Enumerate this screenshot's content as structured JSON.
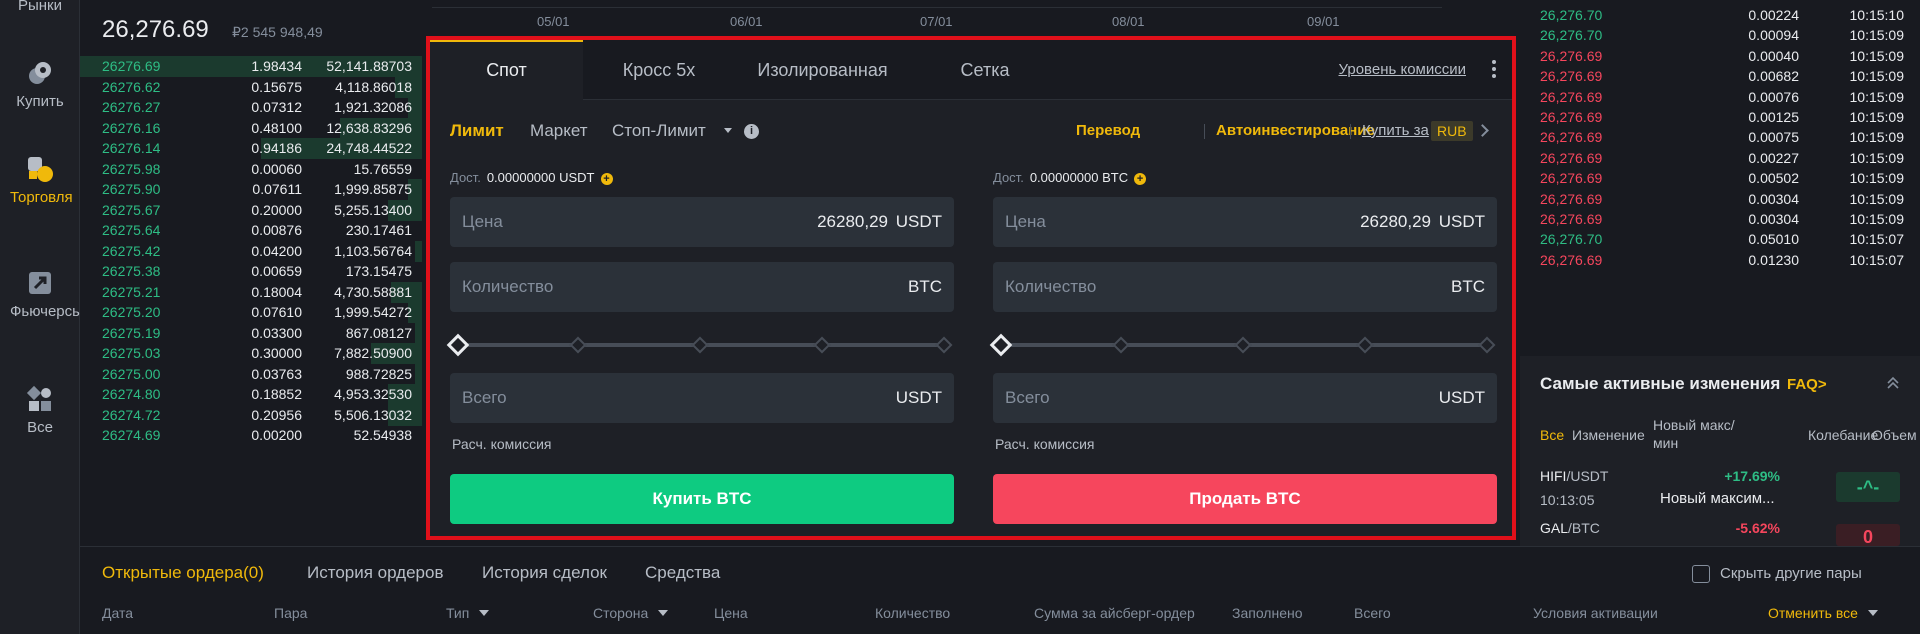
{
  "sidebar": {
    "items": [
      {
        "label": "Рынки",
        "icon": "markets-icon"
      },
      {
        "label": "Купить",
        "icon": "buy-crypto-icon"
      },
      {
        "label": "Торговля",
        "icon": "trade-icon"
      },
      {
        "label": "Фьючерсы",
        "icon": "futures-icon"
      },
      {
        "label": "Все",
        "icon": "all-apps-icon"
      }
    ],
    "active_color": "#f0b90b"
  },
  "orderbook": {
    "last_price": "26,276.69",
    "last_price_rub": "₽2 545 948,49",
    "rows": [
      {
        "price": "26276.69",
        "qty": "1.98434",
        "total": "52,141.88703",
        "depth": 1.0
      },
      {
        "price": "26276.62",
        "qty": "0.15675",
        "total": "4,118.86018",
        "depth": 0.08
      },
      {
        "price": "26276.27",
        "qty": "0.07312",
        "total": "1,921.32086",
        "depth": 0.04
      },
      {
        "price": "26276.16",
        "qty": "0.48100",
        "total": "12,638.83296",
        "depth": 0.24
      },
      {
        "price": "26276.14",
        "qty": "0.94186",
        "total": "24,748.44522",
        "depth": 0.47
      },
      {
        "price": "26275.98",
        "qty": "0.00060",
        "total": "15.76559",
        "depth": 0.0
      },
      {
        "price": "26275.90",
        "qty": "0.07611",
        "total": "1,999.85875",
        "depth": 0.04
      },
      {
        "price": "26275.67",
        "qty": "0.20000",
        "total": "5,255.13400",
        "depth": 0.1
      },
      {
        "price": "26275.64",
        "qty": "0.00876",
        "total": "230.17461",
        "depth": 0.0
      },
      {
        "price": "26275.42",
        "qty": "0.04200",
        "total": "1,103.56764",
        "depth": 0.02
      },
      {
        "price": "26275.38",
        "qty": "0.00659",
        "total": "173.15475",
        "depth": 0.0
      },
      {
        "price": "26275.21",
        "qty": "0.18004",
        "total": "4,730.58881",
        "depth": 0.09
      },
      {
        "price": "26275.20",
        "qty": "0.07610",
        "total": "1,999.54272",
        "depth": 0.04
      },
      {
        "price": "26275.19",
        "qty": "0.03300",
        "total": "867.08127",
        "depth": 0.02
      },
      {
        "price": "26275.03",
        "qty": "0.30000",
        "total": "7,882.50900",
        "depth": 0.15
      },
      {
        "price": "26275.00",
        "qty": "0.03763",
        "total": "988.72825",
        "depth": 0.02
      },
      {
        "price": "26274.80",
        "qty": "0.18852",
        "total": "4,953.32530",
        "depth": 0.1
      },
      {
        "price": "26274.72",
        "qty": "0.20956",
        "total": "5,506.13032",
        "depth": 0.1
      },
      {
        "price": "26274.69",
        "qty": "0.00200",
        "total": "52.54938",
        "depth": 0.0
      }
    ]
  },
  "chart": {
    "dates": [
      "05/01",
      "06/01",
      "07/01",
      "08/01",
      "09/01"
    ]
  },
  "trade_panel": {
    "tabs": [
      "Спот",
      "Кросс 5x",
      "Изолированная",
      "Сетка"
    ],
    "active_tab": "Спот",
    "fee_level": "Уровень комиссии",
    "order_types": [
      "Лимит",
      "Маркет",
      "Стоп-Лимит"
    ],
    "active_order_type": "Лимит",
    "transfer": "Перевод",
    "auto_invest": "Автоинвестирование",
    "buy_for": "Купить за",
    "buy_for_currency": "RUB",
    "buy": {
      "avail_label": "Дост.",
      "avail_value": "0.00000000 USDT",
      "price_label": "Цена",
      "price_value": "26280,29",
      "price_unit": "USDT",
      "qty_label": "Количество",
      "qty_unit": "BTC",
      "total_label": "Всего",
      "total_unit": "USDT",
      "fee_label": "Расч. комиссия",
      "button": "Купить BTC",
      "slider_percent": 0
    },
    "sell": {
      "avail_label": "Дост.",
      "avail_value": "0.00000000 BTC",
      "price_label": "Цена",
      "price_value": "26280,29",
      "price_unit": "USDT",
      "qty_label": "Количество",
      "qty_unit": "BTC",
      "total_label": "Всего",
      "total_unit": "USDT",
      "fee_label": "Расч. комиссия",
      "button": "Продать BTC",
      "slider_percent": 0
    }
  },
  "trades": [
    {
      "price": "26,276.70",
      "qty": "0.00224",
      "time": "10:15:10",
      "side": "up"
    },
    {
      "price": "26,276.70",
      "qty": "0.00094",
      "time": "10:15:09",
      "side": "up"
    },
    {
      "price": "26,276.69",
      "qty": "0.00040",
      "time": "10:15:09",
      "side": "dn"
    },
    {
      "price": "26,276.69",
      "qty": "0.00682",
      "time": "10:15:09",
      "side": "dn"
    },
    {
      "price": "26,276.69",
      "qty": "0.00076",
      "time": "10:15:09",
      "side": "dn"
    },
    {
      "price": "26,276.69",
      "qty": "0.00125",
      "time": "10:15:09",
      "side": "dn"
    },
    {
      "price": "26,276.69",
      "qty": "0.00075",
      "time": "10:15:09",
      "side": "dn"
    },
    {
      "price": "26,276.69",
      "qty": "0.00227",
      "time": "10:15:09",
      "side": "dn"
    },
    {
      "price": "26,276.69",
      "qty": "0.00502",
      "time": "10:15:09",
      "side": "dn"
    },
    {
      "price": "26,276.69",
      "qty": "0.00304",
      "time": "10:15:09",
      "side": "dn"
    },
    {
      "price": "26,276.69",
      "qty": "0.00304",
      "time": "10:15:09",
      "side": "dn"
    },
    {
      "price": "26,276.70",
      "qty": "0.05010",
      "time": "10:15:07",
      "side": "up"
    },
    {
      "price": "26,276.69",
      "qty": "0.01230",
      "time": "10:15:07",
      "side": "dn"
    }
  ],
  "movers": {
    "title": "Самые активные изменения",
    "faq": "FAQ>",
    "tabs": [
      "Все",
      "Изменение",
      "Новый макс/ мин",
      "Колебание",
      "Объем"
    ],
    "active_tab": "Все",
    "items": [
      {
        "base": "HIFI",
        "quote": "/USDT",
        "time": "10:13:05",
        "change": "+17.69%",
        "desc": "Новый максим...",
        "badge": "-^-",
        "dir": "up"
      },
      {
        "base": "GAL",
        "quote": "/BTC",
        "change": "-5.62%",
        "badge": "0",
        "dir": "dn"
      }
    ]
  },
  "bottom": {
    "tabs": [
      "Открытые ордера(0)",
      "История ордеров",
      "История сделок",
      "Средства"
    ],
    "active_tab": "Открытые ордера(0)",
    "hide_pairs": "Скрыть другие пары",
    "columns": [
      "Дата",
      "Пара",
      "Тип",
      "Сторона",
      "Цена",
      "Количество",
      "Сумма за айсберг-ордер",
      "Заполнено",
      "Всего",
      "Условия активации"
    ],
    "cancel_all": "Отменить все"
  },
  "colors": {
    "accent": "#f0b90b",
    "buy": "#0ecb81",
    "sell": "#f6465d",
    "highlight_border": "#e0101a"
  }
}
